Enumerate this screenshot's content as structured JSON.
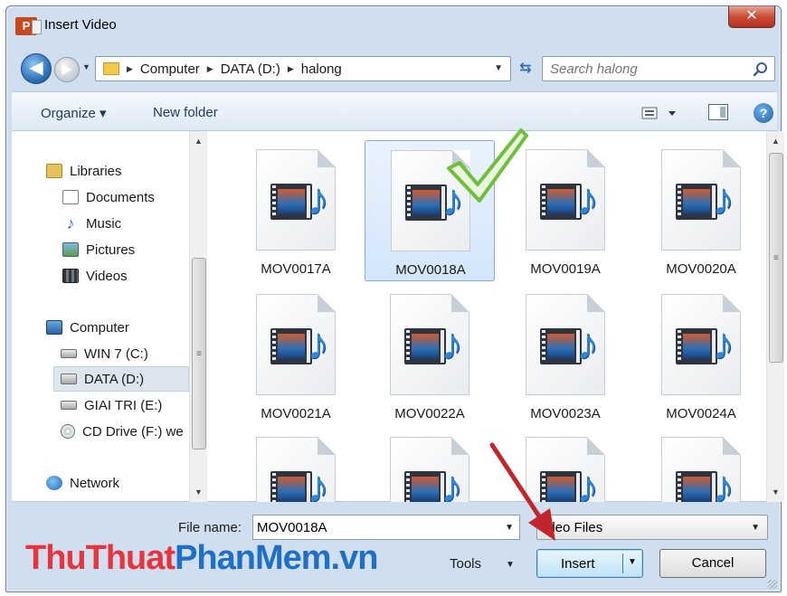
{
  "window": {
    "title": "Insert Video",
    "app_icon_letter": "P",
    "close_symbol": "✕"
  },
  "navbar": {
    "back_symbol": "◀",
    "forward_symbol": "▶",
    "breadcrumbs": [
      "Computer",
      "DATA (D:)",
      "halong"
    ],
    "search_placeholder": "Search halong"
  },
  "toolbar": {
    "organize_label": "Organize ▾",
    "new_folder_label": "New folder",
    "help_label": "?"
  },
  "nav_pane": {
    "items": [
      {
        "label": "Libraries",
        "icon": "libraries-icon"
      },
      {
        "label": "Documents",
        "icon": "documents-icon"
      },
      {
        "label": "Music",
        "icon": "music-icon"
      },
      {
        "label": "Pictures",
        "icon": "pictures-icon"
      },
      {
        "label": "Videos",
        "icon": "videos-icon"
      },
      {
        "label": "Computer",
        "icon": "computer-icon"
      },
      {
        "label": "WIN 7 (C:)",
        "icon": "drive-icon"
      },
      {
        "label": "DATA (D:)",
        "icon": "drive-icon",
        "selected": true
      },
      {
        "label": "GIAI TRI (E:)",
        "icon": "drive-icon"
      },
      {
        "label": "CD Drive (F:) we",
        "icon": "cd-drive-icon"
      },
      {
        "label": "Network",
        "icon": "network-icon"
      }
    ]
  },
  "files": {
    "items": [
      {
        "name": "MOV0017A"
      },
      {
        "name": "MOV0018A",
        "selected": true
      },
      {
        "name": "MOV0019A"
      },
      {
        "name": "MOV0020A"
      },
      {
        "name": "MOV0021A"
      },
      {
        "name": "MOV0022A"
      },
      {
        "name": "MOV0023A"
      },
      {
        "name": "MOV0024A"
      },
      {
        "name": ""
      },
      {
        "name": ""
      },
      {
        "name": ""
      },
      {
        "name": ""
      }
    ]
  },
  "bottom": {
    "file_name_label": "File name:",
    "file_name_value": "MOV0018A",
    "file_type_value": "ideo Files",
    "tools_label": "Tools",
    "insert_label": "Insert",
    "cancel_label": "Cancel"
  },
  "watermark": {
    "part_a": "ThuThuat",
    "part_b": "PhanMem",
    "part_c": ".vn"
  },
  "colors": {
    "accent": "#3c7fb1",
    "watermark_red": "#e8343c",
    "watermark_blue": "#1f6fc4",
    "checkmark_green": "#6fbf3a",
    "annotation_arrow": "#c0262b"
  }
}
